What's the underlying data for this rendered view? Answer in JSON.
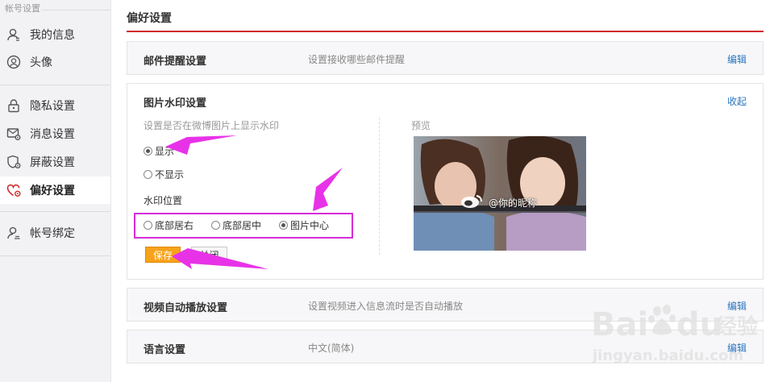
{
  "sidebar": {
    "group_title": "帐号设置",
    "items": [
      {
        "label": "我的信息",
        "icon": "user-icon",
        "active": false
      },
      {
        "label": "头像",
        "icon": "avatar-icon",
        "active": false
      },
      {
        "label": "隐私设置",
        "icon": "lock-icon",
        "active": false
      },
      {
        "label": "消息设置",
        "icon": "message-gear-icon",
        "active": false
      },
      {
        "label": "屏蔽设置",
        "icon": "shield-gear-icon",
        "active": false
      },
      {
        "label": "偏好设置",
        "icon": "heart-gear-icon",
        "active": true
      },
      {
        "label": "帐号绑定",
        "icon": "user-link-icon",
        "active": false
      }
    ]
  },
  "main": {
    "title": "偏好设置",
    "accent_color": "#d02b2b",
    "mail": {
      "title": "邮件提醒设置",
      "desc": "设置接收哪些邮件提醒",
      "action": "编辑"
    },
    "watermark": {
      "title": "图片水印设置",
      "action": "收起",
      "desc": "设置是否在微博图片上显示水印",
      "show_label": "显示",
      "hide_label": "不显示",
      "show_selected": true,
      "position_title": "水印位置",
      "positions": [
        "底部居右",
        "底部居中",
        "图片中心"
      ],
      "selected_position": "图片中心",
      "save_label": "保存",
      "close_label": "关闭",
      "preview_label": "预览",
      "preview_watermark": "@你的昵称"
    },
    "video": {
      "title": "视频自动播放设置",
      "desc": "设置视频进入信息流时是否自动播放",
      "action": "编辑"
    },
    "language": {
      "title": "语言设置",
      "desc": "中文(简体)",
      "action": "编辑"
    }
  },
  "overlay": {
    "annotation_color": "#e832e8",
    "baidu_logo_text": "Bai",
    "baidu_logo_suffix": "du",
    "baidu_jingyan": "经验",
    "baidu_url": "jingyan.baidu.com"
  }
}
